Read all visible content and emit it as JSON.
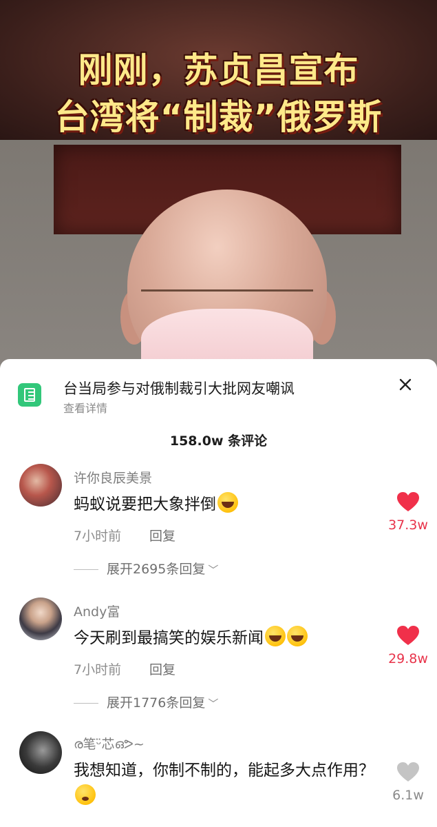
{
  "video": {
    "headline_line1": "刚刚，苏贞昌宣布",
    "headline_line2": "台湾将“制裁”俄罗斯"
  },
  "sheet": {
    "topic_title": "台当局参与对俄制裁引大批网友嘲讽",
    "topic_sub": "查看详情",
    "comment_count": "158.0w 条评论"
  },
  "comments": [
    {
      "username": "许你良辰美景",
      "text": "蚂蚁说要把大象拌倒",
      "time": "7小时前",
      "reply": "回复",
      "expand": "展开2695条回复",
      "likes": "37.3w",
      "liked": true
    },
    {
      "username": "Andy富",
      "text": "今天刷到最搞笑的娱乐新闻",
      "time": "7小时前",
      "reply": "回复",
      "expand": "展开1776条回复",
      "likes": "29.8w",
      "liked": true
    },
    {
      "username": "ര笔ᵕ̈芯ഒᕗ~",
      "text": "我想知道，你制不制的，能起多大点作用？",
      "likes": "6.1w",
      "liked": false
    }
  ],
  "colors": {
    "like_red": "#f0304a",
    "like_grey": "#bdbdbd",
    "count_red": "#e8334a",
    "icon_green": "#32c77a"
  }
}
